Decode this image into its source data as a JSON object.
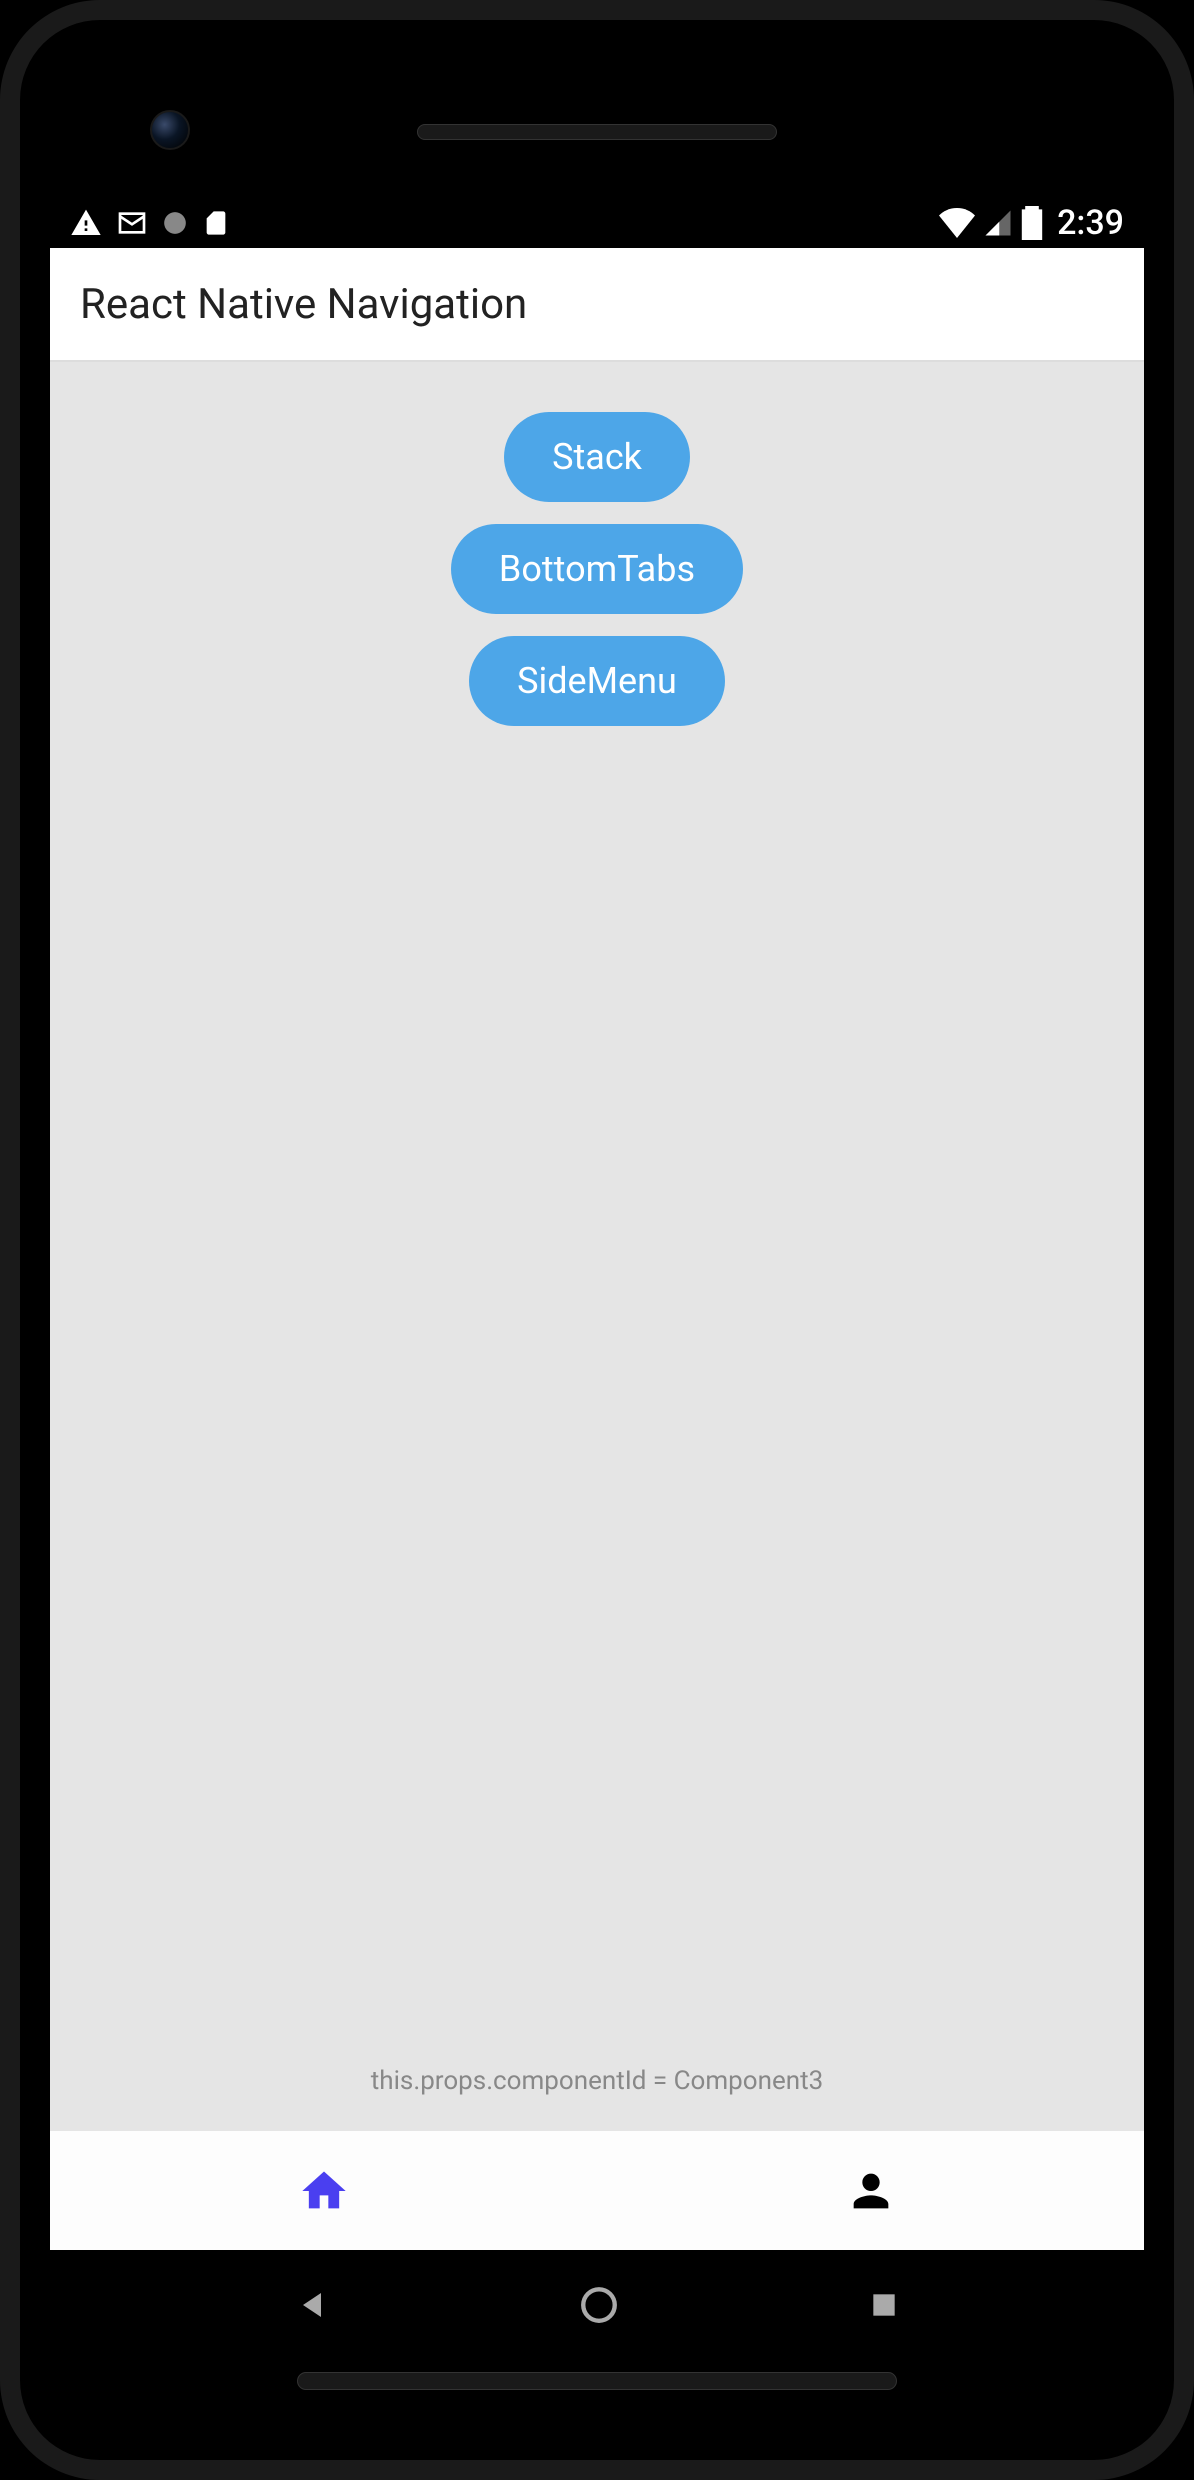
{
  "statusBar": {
    "time": "2:39"
  },
  "header": {
    "title": "React Native Navigation"
  },
  "buttons": {
    "stack": "Stack",
    "bottomTabs": "BottomTabs",
    "sideMenu": "SideMenu"
  },
  "footer": {
    "componentIdText": "this.props.componentId = Component3"
  },
  "colors": {
    "buttonBg": "#4da6e8",
    "activeTab": "#4a3ff0",
    "inactiveTab": "#000000"
  }
}
